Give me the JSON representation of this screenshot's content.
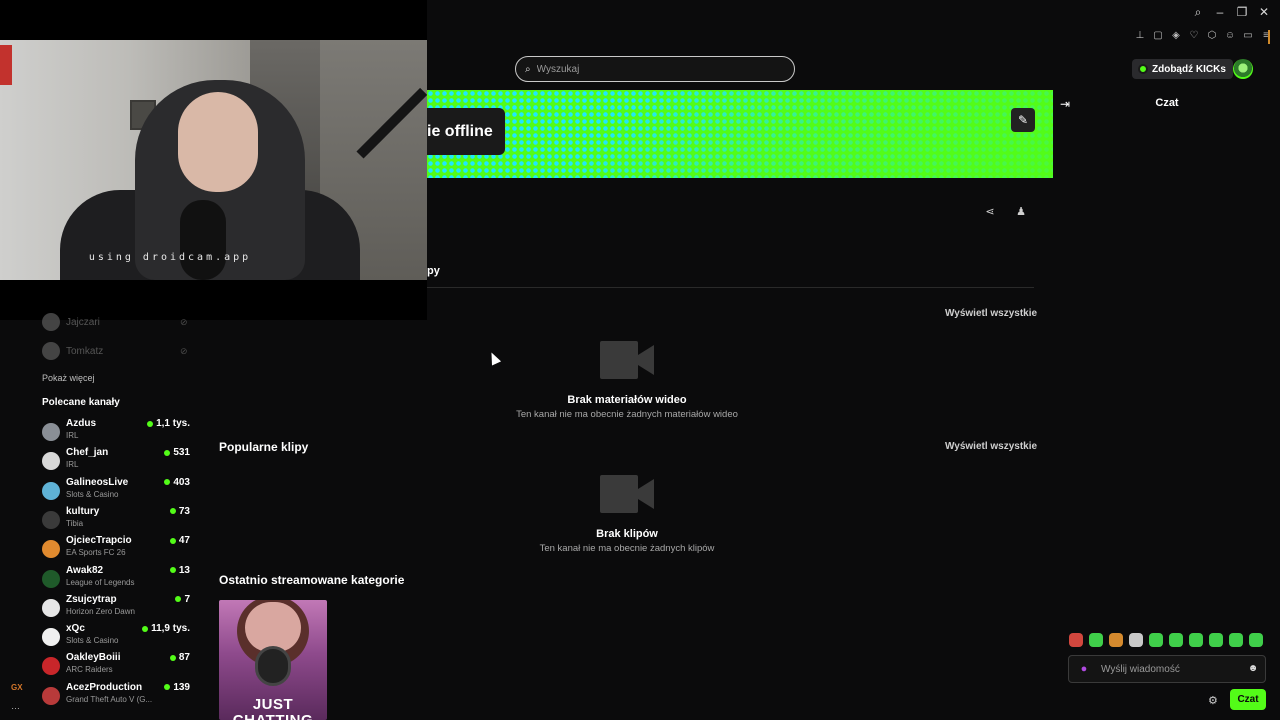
{
  "search": {
    "placeholder": "Wyszukaj"
  },
  "header": {
    "kicks_label": "Zdobądź KICKs"
  },
  "banner": {
    "offline_text": "ie offline"
  },
  "tabs": {
    "partial_tab": "py"
  },
  "webcam": {
    "watermark": "using droidcam.app"
  },
  "sidebar": {
    "faded": [
      {
        "name": "Jajczari"
      },
      {
        "name": "Tomkatz"
      }
    ],
    "show_more": "Pokaż więcej",
    "recommended_title": "Polecane kanały",
    "channels": [
      {
        "name": "Azdus",
        "category": "IRL",
        "viewers": "1,1 tys.",
        "color": "#8a8f96"
      },
      {
        "name": "Chef_jan",
        "category": "IRL",
        "viewers": "531",
        "color": "#d8d8d8"
      },
      {
        "name": "GalineosLive",
        "category": "Slots & Casino",
        "viewers": "403",
        "color": "#5fb2d6"
      },
      {
        "name": "kultury",
        "category": "Tibia",
        "viewers": "73",
        "color": "#3a3a3a"
      },
      {
        "name": "OjciecTrapcio",
        "category": "EA Sports FC 26",
        "viewers": "47",
        "color": "#e08a2f"
      },
      {
        "name": "Awak82",
        "category": "League of Legends",
        "viewers": "13",
        "color": "#1f5a2a"
      },
      {
        "name": "Zsujcytrap",
        "category": "Horizon Zero Dawn",
        "viewers": "7",
        "color": "#e6e6e6"
      },
      {
        "name": "xQc",
        "category": "Slots & Casino",
        "viewers": "11,9 tys.",
        "color": "#f0f0f0"
      },
      {
        "name": "OakleyBoiii",
        "category": "ARC Raiders",
        "viewers": "87",
        "color": "#c8262a"
      },
      {
        "name": "AcezProduction",
        "category": "Grand Theft Auto V (G...",
        "viewers": "139",
        "color": "#b83a3a"
      }
    ]
  },
  "main": {
    "videos": {
      "view_all": "Wyświetl wszystkie",
      "empty_title": "Brak materiałów wideo",
      "empty_sub": "Ten kanał nie ma obecnie żadnych materiałów wideo"
    },
    "clips": {
      "title": "Popularne klipy",
      "view_all": "Wyświetl wszystkie",
      "empty_title": "Brak klipów",
      "empty_sub": "Ten kanał nie ma obecnie żadnych klipów"
    },
    "categories": {
      "title": "Ostatnio streamowane kategorie",
      "card_label": "JUST CHATTING"
    }
  },
  "chat": {
    "title": "Czat",
    "placeholder": "Wyślij wiadomość",
    "send_label": "Czat"
  },
  "misc": {
    "gx_label": "GX"
  },
  "colors": {
    "accent": "#53fc18",
    "banner_dots": "#1ee8ff"
  }
}
